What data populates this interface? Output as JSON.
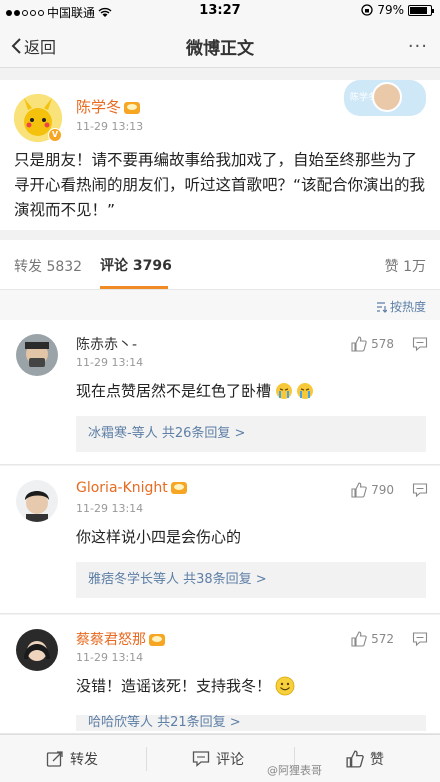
{
  "status_bar": {
    "carrier": "中国联通",
    "time": "13:27",
    "battery_pct": "79%"
  },
  "nav": {
    "back_label": "返回",
    "title": "微博正文",
    "more": "···"
  },
  "post": {
    "author": "陈学冬",
    "time": "11-29 13:13",
    "text": "只是朋友！请不要再编故事给我加戏了，自始至终那些为了寻开心看热闹的朋友们，听过这首歌吧？“该配合你演出的我演视而不见！”",
    "sticker_label": "陈学冬"
  },
  "tabs": {
    "repost": "转发 5832",
    "comments": "评论 3796",
    "likes": "赞 1万"
  },
  "sort": {
    "label": "按热度"
  },
  "comments": [
    {
      "name": "陈赤赤丶-",
      "name_color": "#333333",
      "time": "11-29 13:14",
      "likes": "578",
      "text": "现在点赞居然不是红色了卧槽",
      "sub": "冰霜寒-等人  共26条回复 >"
    },
    {
      "name": "Gloria-Knight",
      "name_color": "#e86a20",
      "time": "11-29 13:14",
      "likes": "790",
      "text": "你这样说小四是会伤心的",
      "sub": "雅痞冬学长等人  共38条回复 >"
    },
    {
      "name": "蔡蔡君怒那",
      "name_color": "#e86a20",
      "time": "11-29 13:14",
      "likes": "572",
      "text": "没错！造谣该死！支持我冬！",
      "sub": "哈哈欣等人  共21条回复 >"
    }
  ],
  "toolbar": {
    "repost": "转发",
    "comment": "评论",
    "like": "赞"
  },
  "watermark": "@阿狸表哥"
}
